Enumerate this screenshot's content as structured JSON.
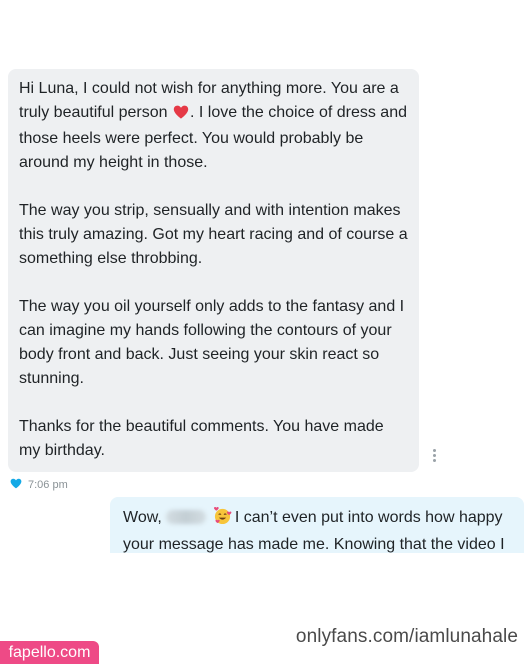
{
  "incoming_message": {
    "p1_a": "Hi Luna, I could not wish for anything more. You are a truly beautiful person",
    "p1_b": ". I love the choice of dress and those heels were perfect. You would probably be around my height in those.",
    "p2": "The way you strip, sensually and with intention makes this truly amazing. Got my heart racing and of course a something else throbbing.",
    "p3": "The way you oil yourself only adds to the fantasy and I can imagine my hands following the contours of your body front and back. Just seeing your skin react so stunning.",
    "p4": "Thanks for the beautiful comments. You have made my birthday.",
    "inline_icon": "red-heart-icon",
    "timestamp": "7:06 pm",
    "meta_icon": "blue-heart-icon"
  },
  "outgoing_message": {
    "prefix": "Wow,",
    "emoji_icon": "smiling-face-with-hearts-icon",
    "text": "I can’t even put into words how happy your message has made me. Knowing that the video I"
  },
  "watermarks": {
    "right": "onlyfans.com/iamlunahale",
    "left": "fapello.com"
  },
  "colors": {
    "incoming_bubble": "#eef0f2",
    "outgoing_bubble": "#e6f5fc",
    "left_watermark_bg": "#ee4a86"
  }
}
